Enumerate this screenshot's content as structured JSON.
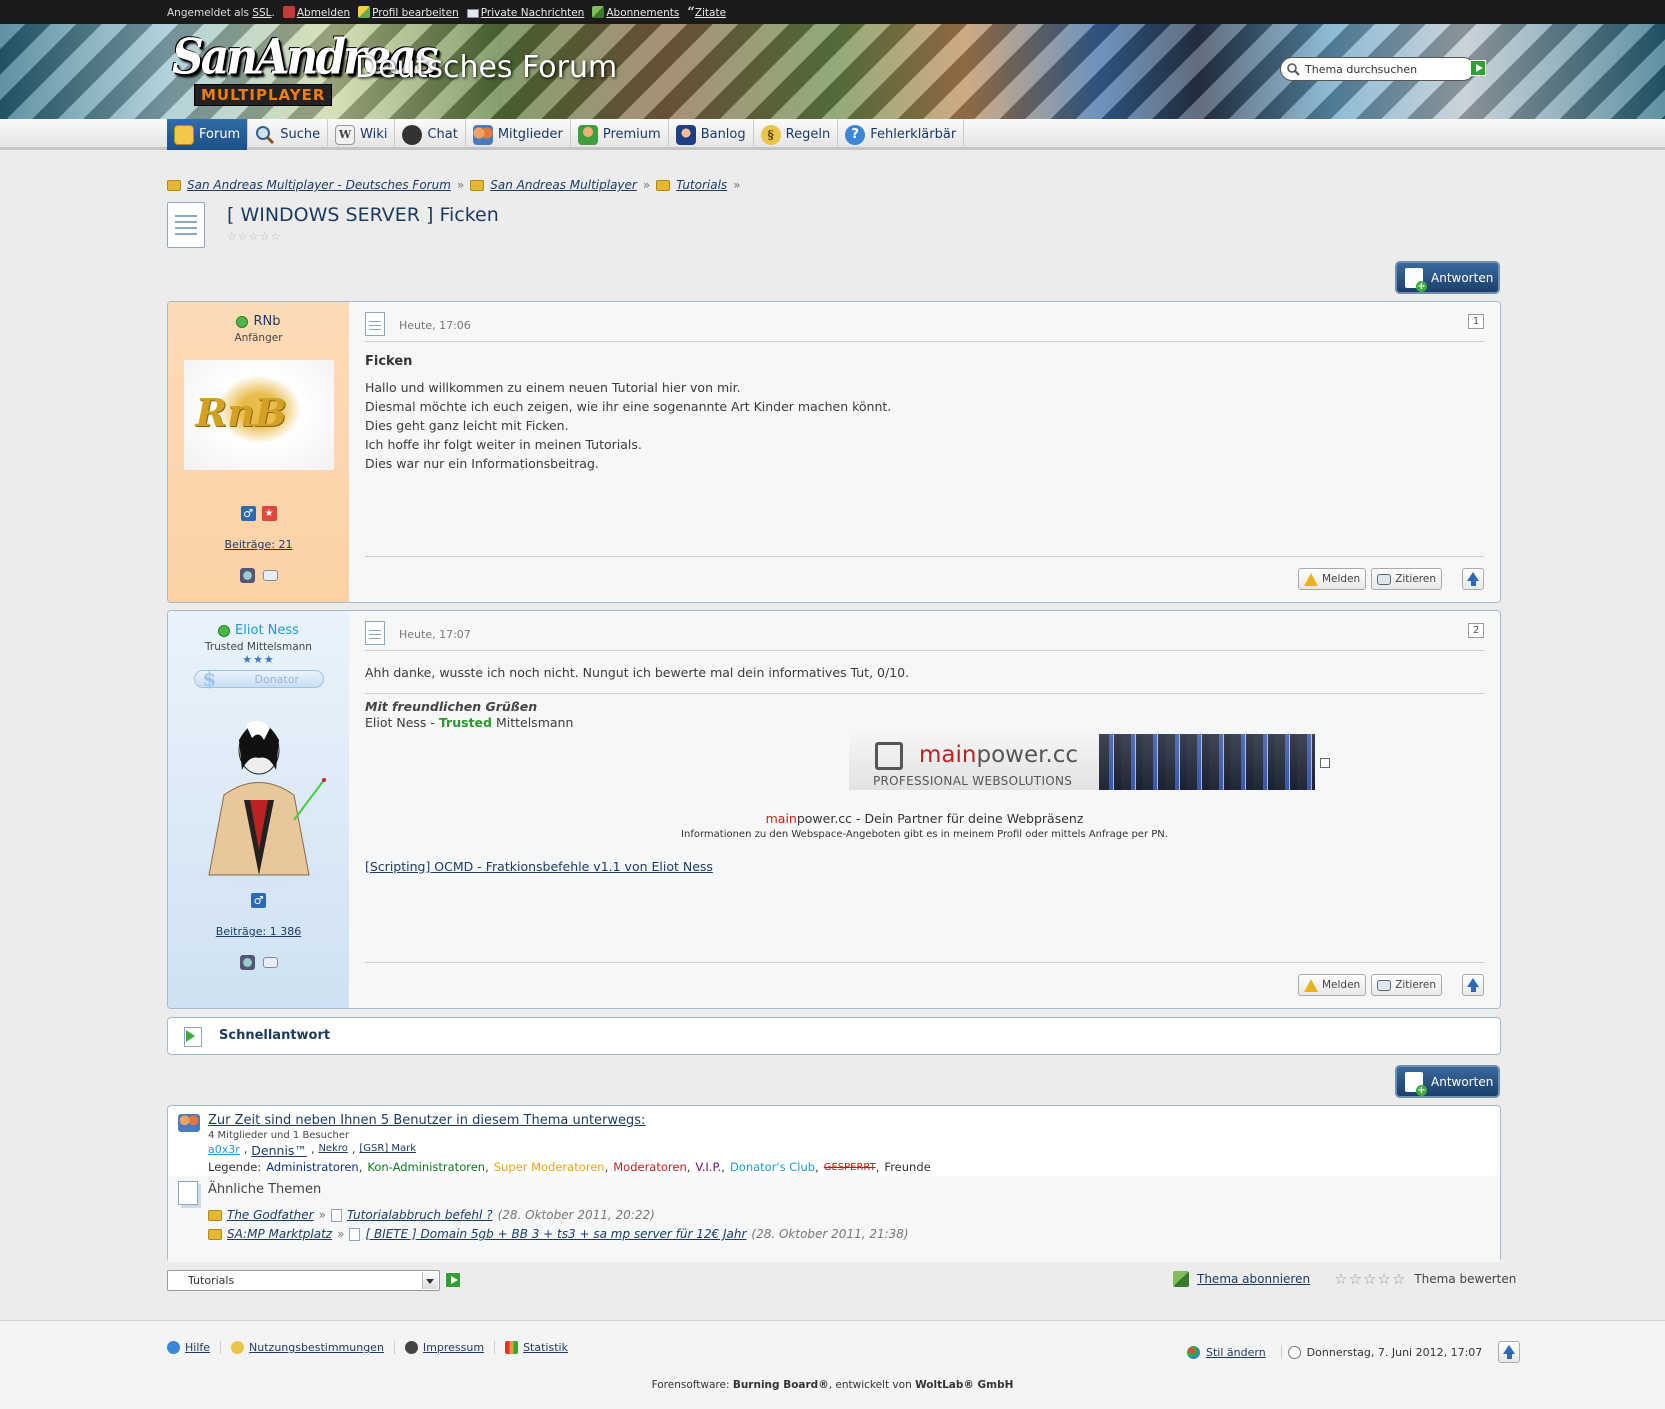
{
  "userbar": {
    "logged_in_prefix": "Angemeldet als",
    "username": "SSL",
    "suffix": ".",
    "links": [
      "Abmelden",
      "Profil bearbeiten",
      "Private Nachrichten",
      "Abonnements",
      "Zitate"
    ]
  },
  "header": {
    "logo_top": "SanAndreas",
    "logo_bottom": "MULTIPLAYER",
    "forum_title": "Deutsches Forum",
    "search_placeholder": "Thema durchsuchen"
  },
  "nav": [
    "Forum",
    "Suche",
    "Wiki",
    "Chat",
    "Mitglieder",
    "Premium",
    "Banlog",
    "Regeln",
    "Fehlerklärbär"
  ],
  "breadcrumb": [
    "San Andreas Multiplayer - Deutsches Forum",
    "San Andreas Multiplayer",
    "Tutorials"
  ],
  "thread": {
    "title": "[ WINDOWS SERVER ] Ficken",
    "rating": "☆☆☆☆☆",
    "reply_label": "Antworten"
  },
  "posts": [
    {
      "author": "RNb",
      "rank": "Anfänger",
      "posts_label": "Beiträge: 21",
      "date": "Heute, 17:06",
      "number": "1",
      "subject": "Ficken",
      "lines": [
        "Hallo und willkommen zu einem neuen Tutorial hier von mir.",
        "Diesmal möchte ich euch zeigen, wie ihr eine sogenannte Art Kinder machen könnt.",
        "Dies geht ganz leicht mit Ficken.",
        "Ich hoffe ihr folgt weiter in meinen Tutorials.",
        "Dies war nur ein Informationsbeitrag."
      ]
    },
    {
      "author": "Eliot Ness",
      "rank": "Trusted Mittelsmann",
      "rank_stars": "★★★",
      "badge": "Donator",
      "posts_label": "Beiträge: 1 386",
      "date": "Heute, 17:07",
      "number": "2",
      "text": "Ahh danke, wusste ich noch nicht. Nungut ich bewerte mal dein informatives Tut, 0/10.",
      "sig_greeting": "Mit freundlichen Grüßen",
      "sig_name": "Eliot Ness -",
      "sig_trusted": "Trusted",
      "sig_rank": "Mittelsmann",
      "banner_main": "main",
      "banner_power": "power.cc",
      "banner_sub": "PROFESSIONAL WEBSOLUTIONS",
      "partner_main": "main",
      "partner_rest": "power.cc - Dein Partner für deine Webpräsenz",
      "partner_info": "Informationen zu den Webspace-Angeboten gibt es in meinem Profil oder mittels Anfrage per PN.",
      "sig_link": "[Scripting] OCMD - Fratkionsbefehle v1.1 von Eliot Ness"
    }
  ],
  "post_buttons": {
    "report": "Melden",
    "quote": "Zitieren"
  },
  "quick_reply": "Schnellantwort",
  "online": {
    "title": "Zur Zeit sind neben Ihnen 5 Benutzer in diesem Thema unterwegs:",
    "counts": "4 Mitglieder und 1 Besucher",
    "users": [
      "a0x3r",
      "Dennis™",
      "Nekro",
      "[GSR] Mark"
    ],
    "legend_label": "Legende:",
    "legend": [
      {
        "label": "Administratoren",
        "color": "#0b2f8c"
      },
      {
        "label": "Kon-Administratoren",
        "color": "#0c7a1e"
      },
      {
        "label": "Super Moderatoren",
        "color": "#f0a010"
      },
      {
        "label": "Moderatoren",
        "color": "#c41c1c"
      },
      {
        "label": "V.I.P.",
        "color": "#7a0f7a"
      },
      {
        "label": "Donator's Club",
        "color": "#1a9bd0"
      },
      {
        "label": "GESPERRT",
        "color": "#d01010"
      },
      {
        "label": "Freunde",
        "color": "#333333"
      }
    ]
  },
  "similar": {
    "title": "Ähnliche Themen",
    "items": [
      {
        "board": "The Godfather",
        "thread": "Tutorialabbruch befehl ?",
        "date": "(28. Oktober 2011, 20:22)"
      },
      {
        "board": "SA:MP Marktplatz",
        "thread": "[ BIETE ] Domain 5gb + BB 3 + ts3 + sa mp server für 12€ Jahr",
        "date": "(28. Oktober 2011, 21:38)"
      }
    ]
  },
  "jump": {
    "selected": "Tutorials"
  },
  "thread_actions": {
    "subscribe": "Thema abonnieren",
    "rate": "Thema bewerten",
    "rate_stars": "☆☆☆☆☆"
  },
  "footer": {
    "links": [
      "Hilfe",
      "Nutzungsbestimmungen",
      "Impressum",
      "Statistik"
    ],
    "style": "Stil ändern",
    "date": "Donnerstag, 7. Juni 2012, 17:07",
    "software_prefix": "Forensoftware:",
    "software_name": "Burning Board®",
    "software_mid": ", entwickelt von",
    "software_vendor": "WoltLab® GmbH"
  }
}
